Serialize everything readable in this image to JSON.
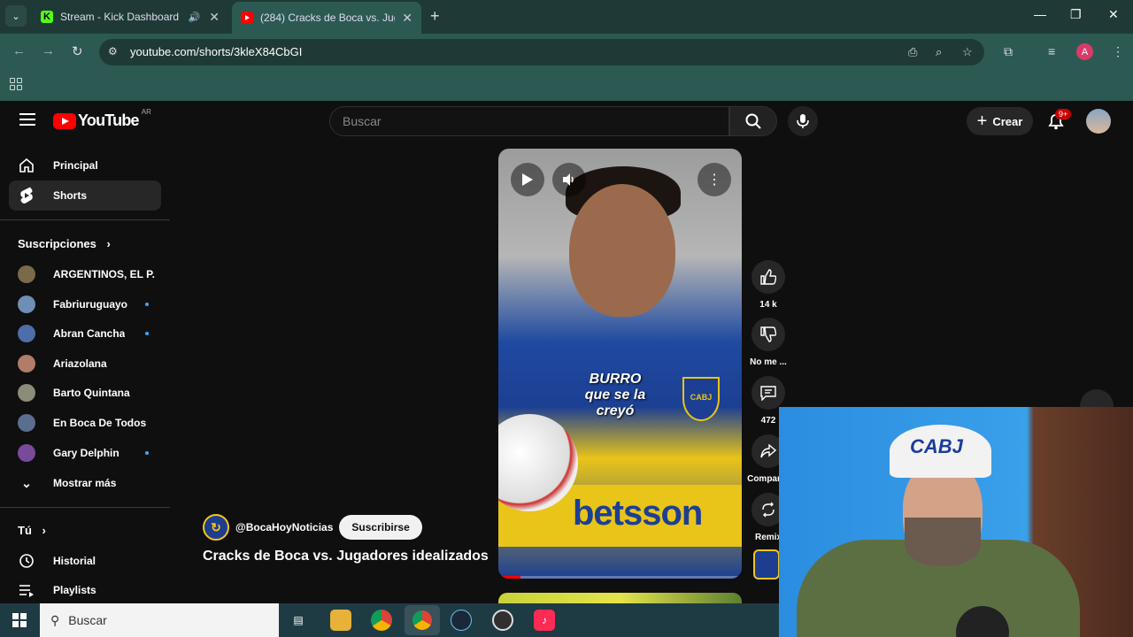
{
  "browser": {
    "tabs": [
      {
        "title": "Stream - Kick Dashboard",
        "favicon": "kick-icon",
        "audio": true
      },
      {
        "title": "(284) Cracks de Boca vs. Jugadores idealizados",
        "favicon": "youtube-icon",
        "active": true
      }
    ],
    "url": "youtube.com/shorts/3kleX84CbGI",
    "profile_initial": "A"
  },
  "youtube": {
    "country_code": "AR",
    "search_placeholder": "Buscar",
    "create_label": "Crear",
    "notifications_badge": "9+",
    "sidebar": {
      "main": [
        {
          "label": "Principal",
          "icon": "home-icon"
        },
        {
          "label": "Shorts",
          "icon": "shorts-icon",
          "active": true
        }
      ],
      "subscriptions_heading": "Suscripciones",
      "subscriptions": [
        {
          "name": "ARGENTINOS, EL P...",
          "new": false,
          "color": "#7a6a4a"
        },
        {
          "name": "Fabriuruguayo",
          "new": true,
          "color": "#6d8fb3"
        },
        {
          "name": "Abran Cancha",
          "new": true,
          "color": "#4d6ea8"
        },
        {
          "name": "Ariazolana",
          "new": false,
          "color": "#b07d6a"
        },
        {
          "name": "Barto Quintana",
          "new": false,
          "color": "#8b8d7a"
        },
        {
          "name": "En Boca De Todos",
          "new": false,
          "color": "#5a6f8f"
        },
        {
          "name": "Gary Delphin",
          "new": true,
          "color": "#7a4a9a"
        }
      ],
      "show_more": "Mostrar más",
      "you_heading": "Tú",
      "you_items": [
        {
          "label": "Historial",
          "icon": "history-icon"
        },
        {
          "label": "Playlists",
          "icon": "playlists-icon"
        }
      ]
    },
    "short": {
      "overlay_caption": "BURRO que se la creyó",
      "crest_text": "CABJ",
      "sponsor": "betsson",
      "channel_handle": "@BocaHoyNoticias",
      "subscribe_label": "Suscribirse",
      "title": "Cracks de Boca vs. Jugadores idealizados",
      "progress": 0.09
    },
    "actions": [
      {
        "icon": "like-icon",
        "label": "14 k"
      },
      {
        "icon": "dislike-icon",
        "label": "No me ..."
      },
      {
        "icon": "comment-icon",
        "label": "472"
      },
      {
        "icon": "share-icon",
        "label": "Compartir"
      },
      {
        "icon": "remix-icon",
        "label": "Remix"
      }
    ]
  },
  "webcam": {
    "cap_text": "CABJ"
  },
  "taskbar": {
    "search_label": "Buscar",
    "apps": [
      "task-view-icon",
      "file-explorer-icon",
      "chrome-icon",
      "chrome-profile-icon",
      "steam-icon",
      "obs-icon",
      "tiktok-icon"
    ]
  }
}
